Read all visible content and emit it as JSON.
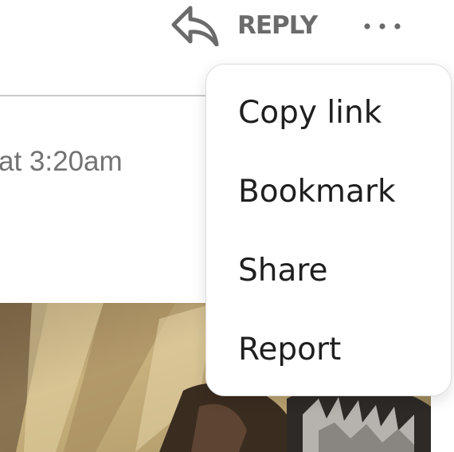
{
  "actions": {
    "reply_label": "REPLY",
    "reply_icon": "reply-arrow-icon",
    "more_icon": "more-horizontal-icon"
  },
  "post": {
    "timestamp_fragment": "at 3:20am",
    "image": "photo-crop"
  },
  "menu": {
    "items": [
      {
        "label": "Copy link"
      },
      {
        "label": "Bookmark"
      },
      {
        "label": "Share"
      },
      {
        "label": "Report"
      }
    ]
  },
  "colors": {
    "action_text": "#6b6b6b",
    "menu_text": "#1f1f1f",
    "timestamp_text": "#727272",
    "divider": "#c9c9c9"
  }
}
